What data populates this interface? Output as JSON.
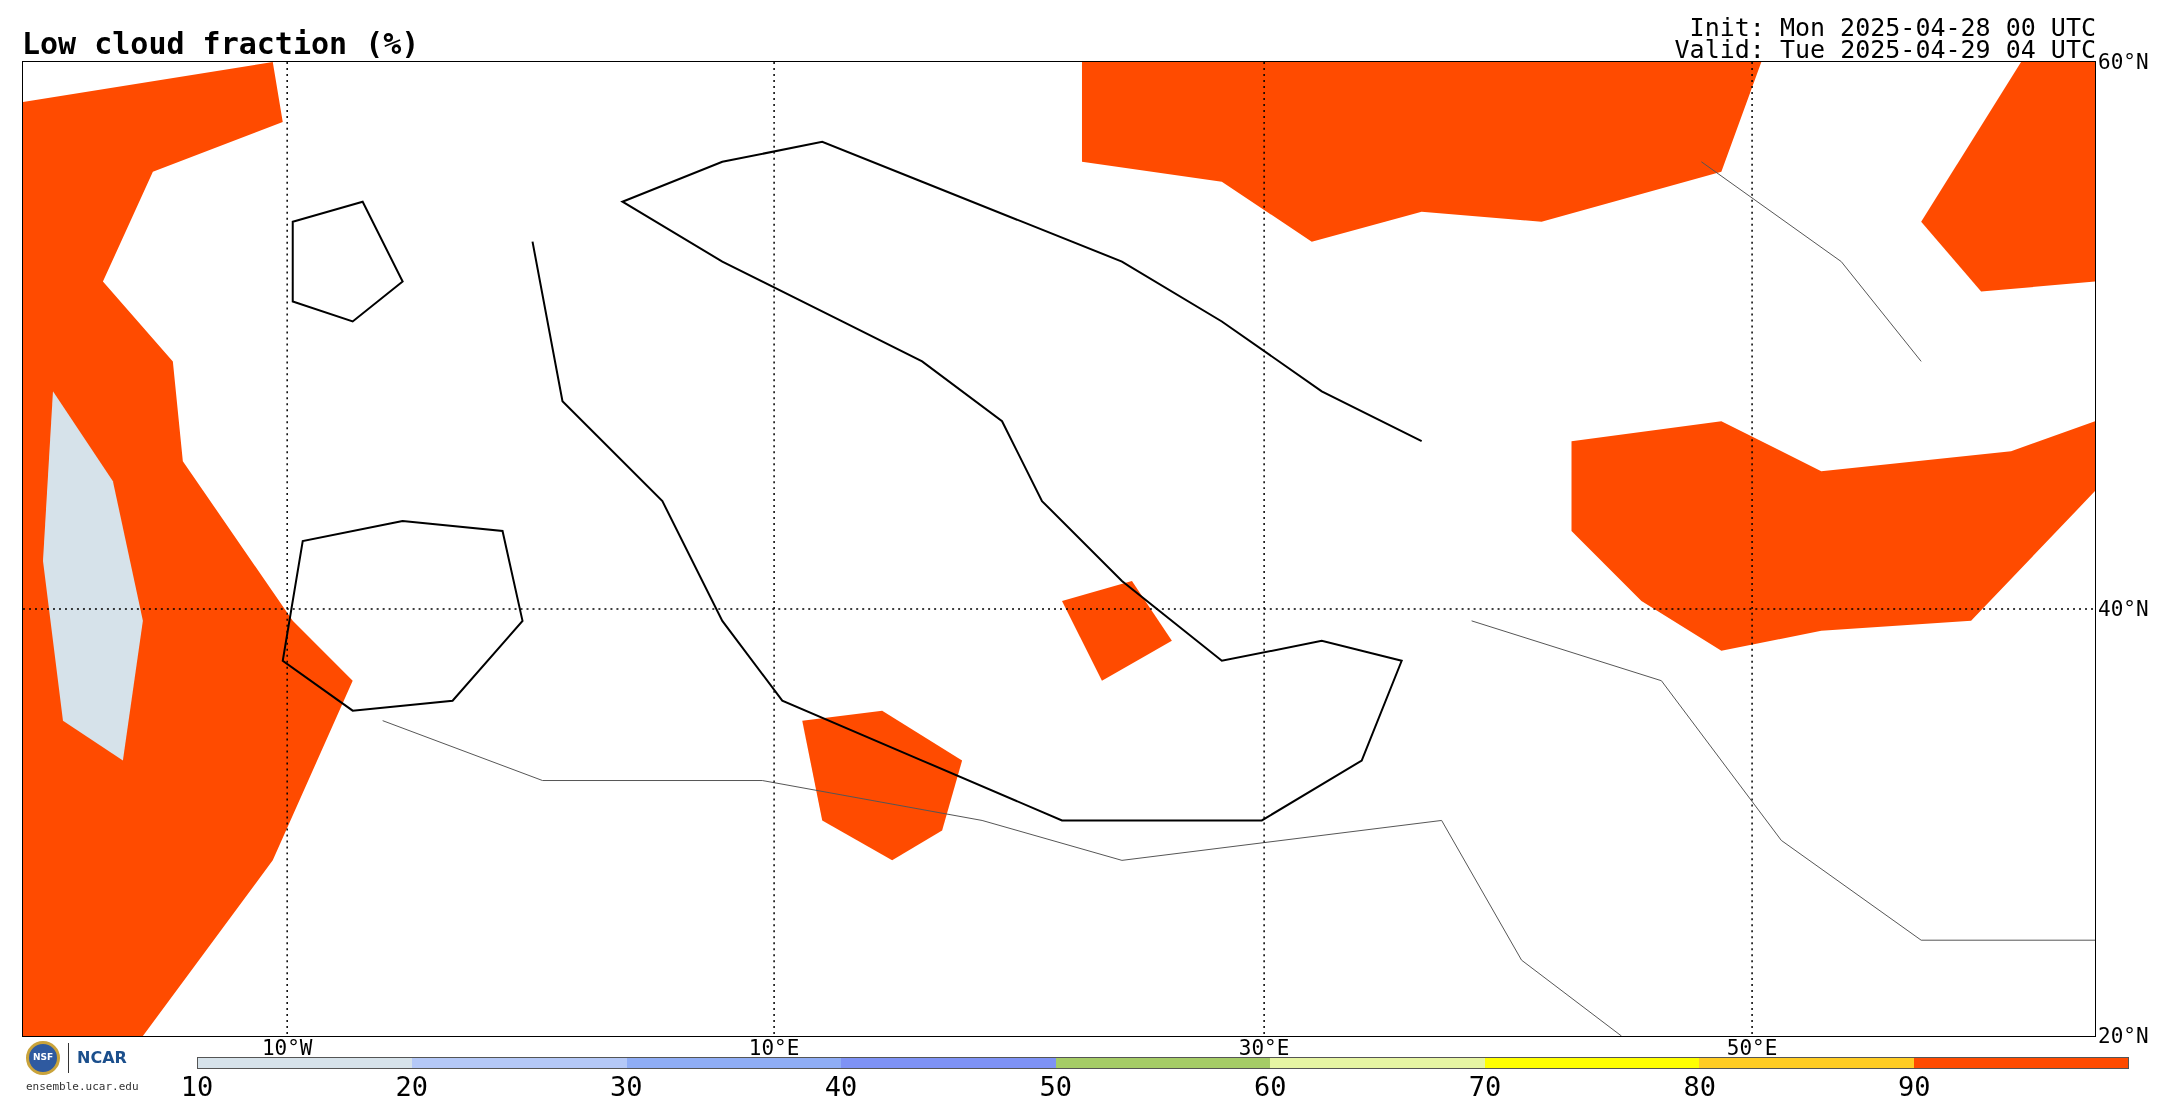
{
  "title": "Low cloud fraction (%)",
  "init": "Init: Mon 2025-04-28 00 UTC",
  "valid": "Valid: Tue 2025-04-29 04 UTC",
  "map": {
    "lon_labels": [
      "10°W",
      "10°E",
      "30°E",
      "50°E"
    ],
    "lat_labels": [
      "60°N",
      "40°N",
      "20°N"
    ]
  },
  "colorbar": {
    "segments": [
      {
        "color": "#d6e2ea"
      },
      {
        "color": "#b4c8f7"
      },
      {
        "color": "#8fadf5"
      },
      {
        "color": "#7e92f5"
      },
      {
        "color": "#a5cc66"
      },
      {
        "color": "#e6f5a3"
      },
      {
        "color": "#ffff00"
      },
      {
        "color": "#ffcc22"
      },
      {
        "color": "#ff4b00"
      }
    ],
    "ticks": [
      "10",
      "20",
      "30",
      "40",
      "50",
      "60",
      "70",
      "80",
      "90"
    ]
  },
  "logos": {
    "seal": "NSF",
    "org": "NCAR",
    "url": "ensemble.ucar.edu"
  }
}
